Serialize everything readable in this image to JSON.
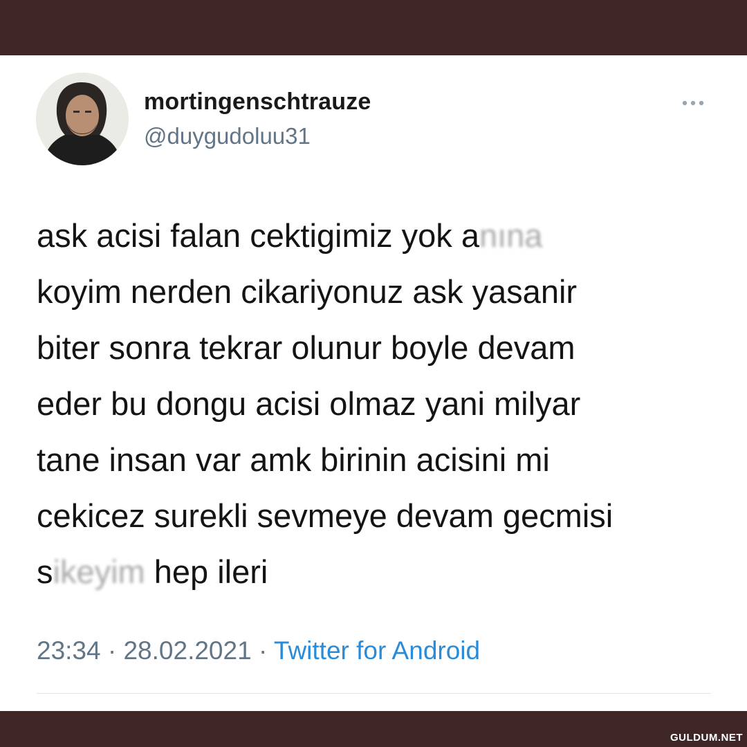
{
  "tweet": {
    "display_name": "mortingenschtrauze",
    "handle": "@duygudoluu31",
    "avatar_icon": "user-avatar-photo",
    "more_icon": "more-horizontal-icon",
    "text_lines": [
      "ask acisi falan cektigimiz yok a",
      "koyim nerden cikariyonuz ask yasanir",
      "biter sonra tekrar olunur boyle devam",
      "eder bu dongu acisi olmaz yani milyar",
      "tane insan var amk birinin acisini mi",
      "cekicez surekli sevmeye devam gecmisi",
      "s"
    ],
    "censored_1": "nına",
    "censored_2": "ikeyim",
    "line7_tail": " hep ileri",
    "time": "23:34",
    "separator": "·",
    "date": "28.02.2021",
    "source": "Twitter for Android"
  },
  "watermark": "GULDUM.NET",
  "colors": {
    "frame": "#3e2626",
    "text": "#141414",
    "muted": "#627586",
    "link": "#2a8cd8"
  }
}
